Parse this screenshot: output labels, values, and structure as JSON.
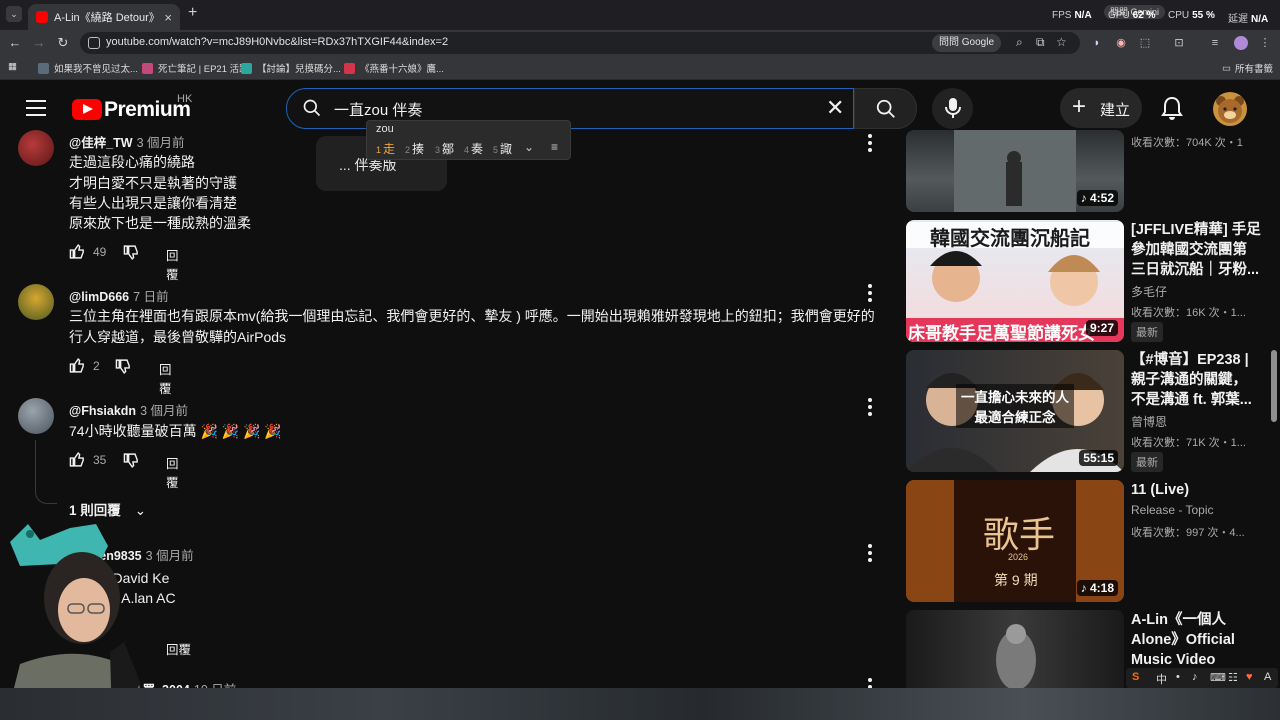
{
  "browser": {
    "active_tab_title": "A-Lin《繞路 Detour》Official M",
    "url": "youtube.com/watch?v=mcJ89H0Nvbc&list=RDx37hTXGIF44&index=2",
    "translate_chip": "問問 Google",
    "perf": {
      "fps_label": "FPS",
      "fps_value": "N/A",
      "gpu_label": "GPU",
      "gpu_value": "62 %",
      "cpu_label": "CPU",
      "cpu_value": "55 %",
      "latency_label": "延遲",
      "latency_value": "N/A"
    },
    "gemini_pill": "問問 Gemini",
    "bookmarks": [
      {
        "label": "如果我不曾见过太...",
        "color": "#5b6b7a"
      },
      {
        "label": "死亡筆記 | EP21 活躍",
        "color": "#c24a7a"
      },
      {
        "label": "【討論】兒摸碼分...",
        "color": "#2aa7a0"
      },
      {
        "label": "《燕番十六娘》鷹...",
        "color": "#d2344b"
      }
    ],
    "all_bookmarks": "所有書籤"
  },
  "masthead": {
    "brand": "Premium",
    "region": "HK",
    "search_value": "一直zou 伴奏",
    "create_label": "建立"
  },
  "ime": {
    "composition": "zou",
    "candidates": [
      {
        "num": "1",
        "char": "走"
      },
      {
        "num": "2",
        "char": "揍"
      },
      {
        "num": "3",
        "char": "鄒"
      },
      {
        "num": "4",
        "char": "奏"
      },
      {
        "num": "5",
        "char": "諏"
      }
    ]
  },
  "suggestion": "... 伴奏版",
  "comments": [
    {
      "author": "@佳梓_TW",
      "time": "3 個月前",
      "lines": [
        "走過這段心痛的繞路",
        "才明白愛不只是執著的守護",
        "有些人出現只是讓你看清楚",
        "原來放下也是一種成熟的溫柔"
      ],
      "likes": "49",
      "reply": "回覆"
    },
    {
      "author": "@limD666",
      "time": "7 日前",
      "lines": [
        "三位主角在裡面也有跟原本mv(給我一個理由忘記、我們會更好的、摯友 ) 呼應。一開始出現賴雅妍發現地上的鈕扣；我們會更好的",
        "行人穿越道，最後曾敬驊的AirPods"
      ],
      "likes": "2",
      "reply": "回覆"
    },
    {
      "author": "@Fhsiakdn",
      "time": "3 個月前",
      "lines": [
        "74小時收聽量破百萬 🎉 🎉 🎉 🎉"
      ],
      "likes": "35",
      "reply": "回覆",
      "replies_toggle": "1 則回覆"
    },
    {
      "author": "@...hen9835",
      "time": "3 個月前",
      "lines": [
        "...大為 David Ke",
        "...蘭 AC A.lan AC"
      ],
      "likes": "",
      "reply": "回覆"
    },
    {
      "author": "@...買_3004",
      "time": "10 日前",
      "lines": [],
      "likes": "",
      "reply": ""
    }
  ],
  "sidebar": [
    {
      "title": "",
      "channel": "",
      "meta": "收看次數：704K 次・1",
      "duration": "4:52",
      "music": true,
      "badge": ""
    },
    {
      "title": "[JFFLIVE精華] 手足參加韓國交流團第三日就沉船｜牙粉...",
      "channel": "多毛仔",
      "meta": "收看次數：16K 次・1...",
      "duration": "9:27",
      "music": false,
      "badge": "最新",
      "thumb_top": "韓國交流團沉船記",
      "thumb_bottom": "床哥教手足萬聖節講死女"
    },
    {
      "title": "【#博音】EP238 | 親子溝通的關鍵，不是溝通 ft. 郭葉...",
      "channel": "曾博恩",
      "meta": "收看次數：71K 次・1...",
      "duration": "55:15",
      "music": false,
      "badge": "最新",
      "thumb_text": "一直擔心未來的人 最適合練正念"
    },
    {
      "title": "11 (Live)",
      "channel": "Release - Topic",
      "meta": "收看次數：997 次・4...",
      "duration": "4:18",
      "music": true,
      "badge": "",
      "thumb_big": "歌手",
      "thumb_year": "2026",
      "thumb_ep": "第 9 期"
    },
    {
      "title": "A-Lin《一個人 Alone》Official Music Video",
      "channel": "",
      "meta": "",
      "duration": "",
      "music": false,
      "badge": ""
    }
  ],
  "ime_tray": [
    "S",
    "中",
    "•",
    "♪",
    "⌨",
    "☷",
    "♥",
    "A"
  ]
}
